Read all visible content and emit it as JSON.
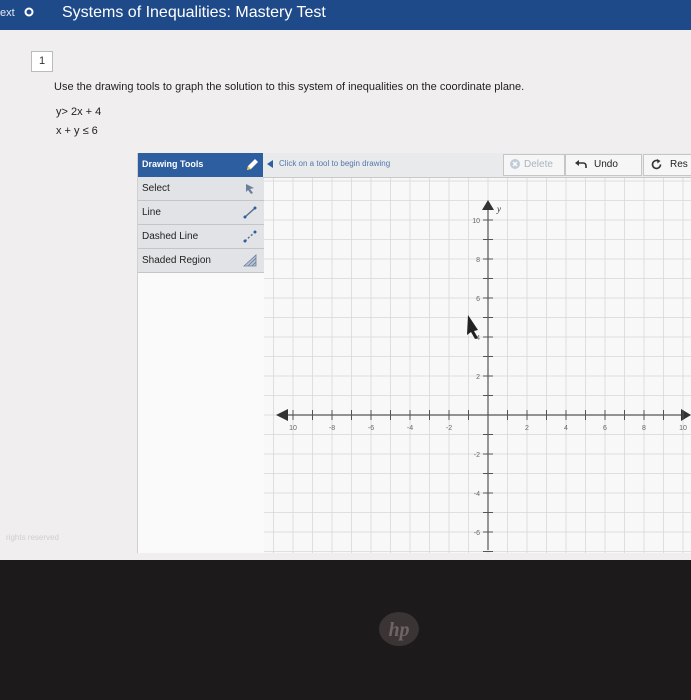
{
  "titlebar": {
    "next_label": "ext",
    "title": "Systems of Inequalities: Mastery Test"
  },
  "question": {
    "number": "1",
    "instructions": "Use the drawing tools to graph the solution to this system of inequalities on the coordinate plane.",
    "inequalities": [
      "y> 2x + 4",
      "x + y ≤ 6"
    ]
  },
  "tools": {
    "header": "Drawing Tools",
    "items": [
      {
        "label": "Select",
        "icon": "pointer-icon"
      },
      {
        "label": "Line",
        "icon": "line-icon"
      },
      {
        "label": "Dashed Line",
        "icon": "dashed-line-icon"
      },
      {
        "label": "Shaded Region",
        "icon": "shaded-region-icon"
      }
    ]
  },
  "toolbar": {
    "hint": "Click on a tool to begin drawing",
    "delete_label": "Delete",
    "undo_label": "Undo",
    "reset_label": "Res"
  },
  "graph": {
    "x_axis_label": "",
    "y_axis_label": "y",
    "x_ticks": [
      "10",
      "-8",
      "-6",
      "-4",
      "-2",
      "2",
      "4",
      "6",
      "8",
      "10"
    ],
    "y_ticks": [
      "10",
      "8",
      "6",
      "4",
      "2",
      "-2",
      "-4",
      "-6"
    ]
  },
  "footer": {
    "reserved": "rights reserved"
  },
  "device": {
    "logo": "hp"
  },
  "colors": {
    "titlebar": "#1f4a8a",
    "tools_header": "#2d5fa0",
    "grid": "#d5d7da",
    "axis": "#7a7a7a"
  }
}
